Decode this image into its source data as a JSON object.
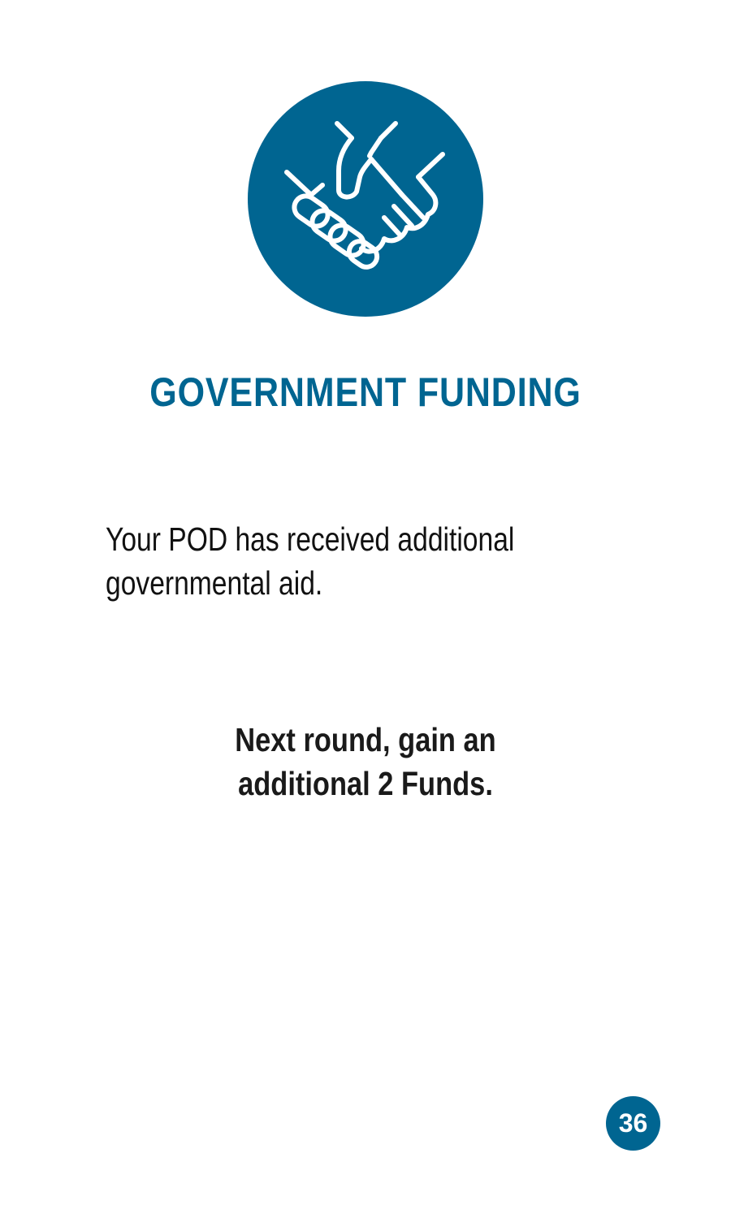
{
  "card": {
    "icon": "handshake-icon",
    "title": "GOVERNMENT FUNDING",
    "description_lines": [
      "Your POD has received additional",
      "governmental aid."
    ],
    "effect_lines": [
      "Next round, gain an",
      "additional 2 Funds."
    ],
    "page_number": "36"
  },
  "colors": {
    "accent": "#006591",
    "text": "#111111",
    "background": "#ffffff"
  }
}
